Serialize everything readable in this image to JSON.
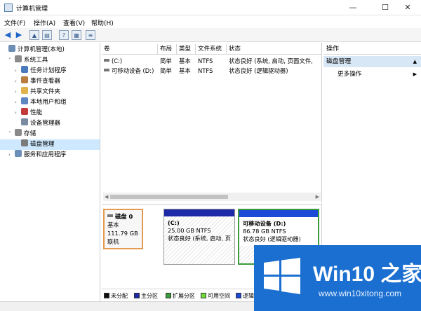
{
  "window": {
    "title": "计算机管理",
    "minimize": "—",
    "maximize": "☐",
    "close": "✕"
  },
  "menu": [
    "文件(F)",
    "操作(A)",
    "查看(V)",
    "帮助(H)"
  ],
  "tree": [
    {
      "label": "计算机管理(本地)",
      "indent": 0,
      "arrow": "",
      "icon": "computer-icon",
      "color": "#6d8fb5"
    },
    {
      "label": "系统工具",
      "indent": 1,
      "arrow": "˅",
      "icon": "tools-icon",
      "color": "#8a8a8a"
    },
    {
      "label": "任务计划程序",
      "indent": 2,
      "arrow": "›",
      "icon": "clock-icon",
      "color": "#4a7bbd"
    },
    {
      "label": "事件查看器",
      "indent": 2,
      "arrow": "›",
      "icon": "log-icon",
      "color": "#b97d3f"
    },
    {
      "label": "共享文件夹",
      "indent": 2,
      "arrow": "›",
      "icon": "folder-icon",
      "color": "#e2b24a"
    },
    {
      "label": "本地用户和组",
      "indent": 2,
      "arrow": "›",
      "icon": "users-icon",
      "color": "#5e86c2"
    },
    {
      "label": "性能",
      "indent": 2,
      "arrow": "›",
      "icon": "performance-icon",
      "color": "#c23a3a"
    },
    {
      "label": "设备管理器",
      "indent": 2,
      "arrow": "",
      "icon": "device-icon",
      "color": "#7a8aa0"
    },
    {
      "label": "存储",
      "indent": 1,
      "arrow": "˅",
      "icon": "storage-icon",
      "color": "#8a8a8a"
    },
    {
      "label": "磁盘管理",
      "indent": 2,
      "arrow": "",
      "icon": "disk-icon",
      "color": "#7b7b7b",
      "selected": true
    },
    {
      "label": "服务和应用程序",
      "indent": 1,
      "arrow": "›",
      "icon": "services-icon",
      "color": "#6b8fb8"
    }
  ],
  "volume_list": {
    "columns": [
      "卷",
      "布局",
      "类型",
      "文件系统",
      "状态"
    ],
    "rows": [
      {
        "name": "(C:)",
        "layout": "简单",
        "type": "基本",
        "fs": "NTFS",
        "status": "状态良好 (系统, 启动, 页面文件,"
      },
      {
        "name": "可移动设备 (D:)",
        "layout": "简单",
        "type": "基本",
        "fs": "NTFS",
        "status": "状态良好 (逻辑驱动器)"
      }
    ]
  },
  "disk": {
    "name": "磁盘 0",
    "type": "基本",
    "size": "111.79 GB",
    "state": "联机"
  },
  "partitions": [
    {
      "label": "(C:)",
      "size": "25.00 GB NTFS",
      "status": "状态良好 (系统, 启动, 页"
    },
    {
      "label": "可移动设备 (D:)",
      "size": "86.78 GB NTFS",
      "status": "状态良好 (逻辑驱动器)"
    }
  ],
  "legend": [
    {
      "label": "未分配",
      "color": "#111111"
    },
    {
      "label": "主分区",
      "color": "#1c2aa8"
    },
    {
      "label": "扩展分区",
      "color": "#3c9b3c"
    },
    {
      "label": "可用空间",
      "color": "#6fdc3c"
    },
    {
      "label": "逻辑",
      "color": "#1c49d6"
    }
  ],
  "actions": {
    "header": "操作",
    "section": "磁盘管理",
    "more": "更多操作"
  },
  "watermark": {
    "brand": "Win10 之家",
    "url": "www.win10xitong.com"
  }
}
